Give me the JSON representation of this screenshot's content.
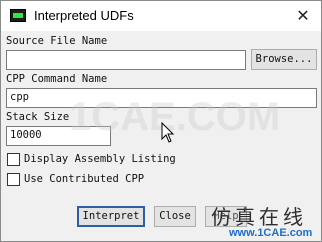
{
  "window": {
    "title": "Interpreted UDFs",
    "close_glyph": "✕"
  },
  "source_file": {
    "label": "Source File Name",
    "value": "",
    "browse_label": "Browse..."
  },
  "cpp_command": {
    "label": "CPP Command Name",
    "value": "cpp"
  },
  "stack_size": {
    "label": "Stack Size",
    "value": "10000"
  },
  "options": {
    "display_assembly": {
      "label": "Display Assembly Listing",
      "checked": false
    },
    "use_contributed_cpp": {
      "label": "Use Contributed CPP",
      "checked": false
    }
  },
  "buttons": {
    "interpret": "Interpret",
    "close": "Close",
    "help": "Help"
  },
  "watermark": {
    "center_text": "1CAE.COM",
    "brand_cn": "仿真在线",
    "brand_url": "www.1CAE.com"
  },
  "colors": {
    "background": "#f0f0f0",
    "titlebar": "#ffffff",
    "default_button_border": "#2a5fa0",
    "watermark_url": "#1d6fc9"
  }
}
